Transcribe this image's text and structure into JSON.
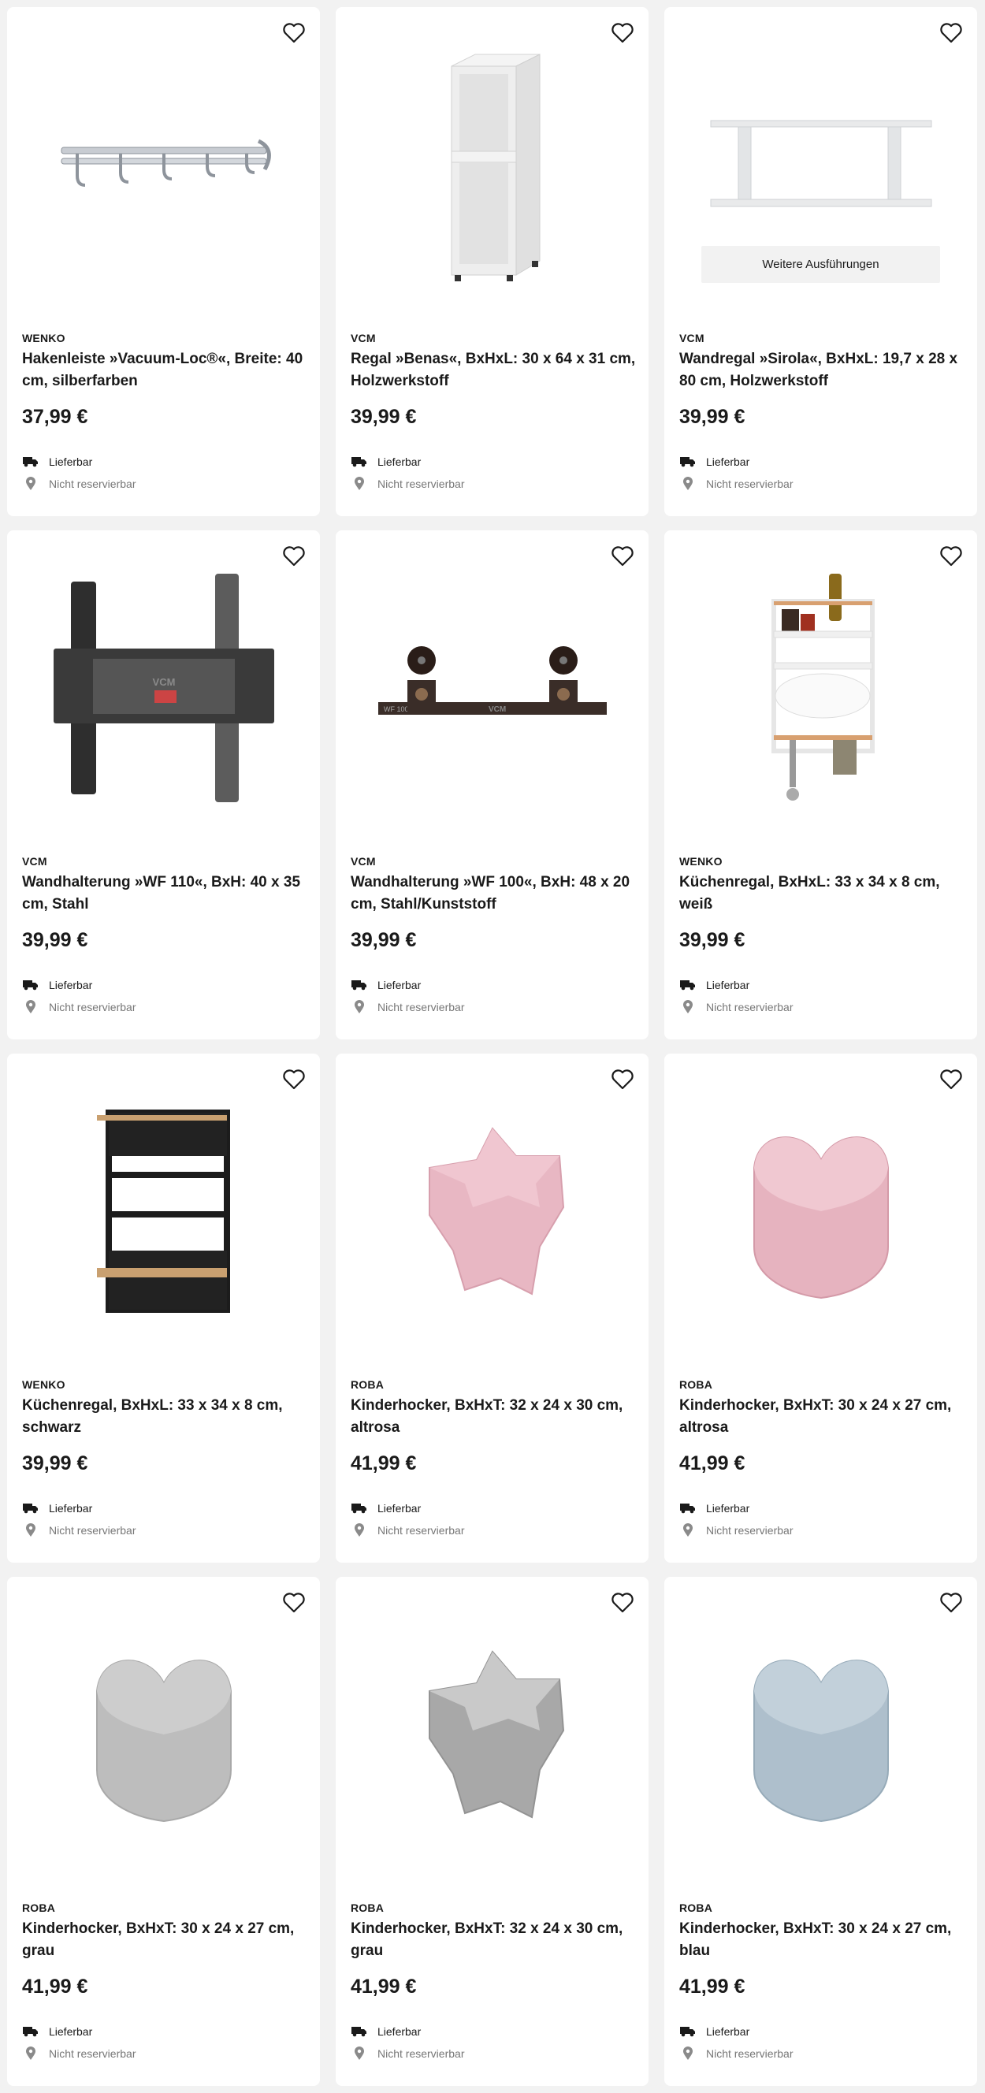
{
  "products": [
    {
      "brand": "WENKO",
      "title": "Hakenleiste »Vacuum-Loc®«, Breite: 40 cm, silberfarben",
      "price": "37,99 €",
      "delivery": "Lieferbar",
      "reserve": "Nicht reservierbar",
      "image": "hook-rail"
    },
    {
      "brand": "VCM",
      "title": "Regal »Benas«, BxHxL: 30 x 64 x 31 cm, Holzwerkstoff",
      "price": "39,99 €",
      "delivery": "Lieferbar",
      "reserve": "Nicht reservierbar",
      "image": "shelf-tower"
    },
    {
      "brand": "VCM",
      "title": "Wandregal »Sirola«, BxHxL: 19,7 x 28 x 80 cm, Holzwerkstoff",
      "price": "39,99 €",
      "delivery": "Lieferbar",
      "reserve": "Nicht reservierbar",
      "image": "wall-shelf",
      "variants_label": "Weitere Ausführungen"
    },
    {
      "brand": "VCM",
      "title": "Wandhalterung »WF 110«, BxH: 40 x 35 cm, Stahl",
      "price": "39,99 €",
      "delivery": "Lieferbar",
      "reserve": "Nicht reservierbar",
      "image": "tv-mount-wf110"
    },
    {
      "brand": "VCM",
      "title": "Wandhalterung »WF 100«, BxH: 48 x 20 cm, Stahl/Kunststoff",
      "price": "39,99 €",
      "delivery": "Lieferbar",
      "reserve": "Nicht reservierbar",
      "image": "tv-mount-wf100"
    },
    {
      "brand": "WENKO",
      "title": "Küchenregal, BxHxL: 33 x 34 x 8 cm, weiß",
      "price": "39,99 €",
      "delivery": "Lieferbar",
      "reserve": "Nicht reservierbar",
      "image": "kitchen-rack-white"
    },
    {
      "brand": "WENKO",
      "title": "Küchenregal, BxHxL: 33 x 34 x 8 cm, schwarz",
      "price": "39,99 €",
      "delivery": "Lieferbar",
      "reserve": "Nicht reservierbar",
      "image": "kitchen-rack-black"
    },
    {
      "brand": "ROBA",
      "title": "Kinderhocker, BxHxT: 32 x 24 x 30 cm, altrosa",
      "price": "41,99 €",
      "delivery": "Lieferbar",
      "reserve": "Nicht reservierbar",
      "image": "stool-star-pink"
    },
    {
      "brand": "ROBA",
      "title": "Kinderhocker, BxHxT: 30 x 24 x 27 cm, altrosa",
      "price": "41,99 €",
      "delivery": "Lieferbar",
      "reserve": "Nicht reservierbar",
      "image": "stool-heart-pink"
    },
    {
      "brand": "ROBA",
      "title": "Kinderhocker, BxHxT: 30 x 24 x 27 cm, grau",
      "price": "41,99 €",
      "delivery": "Lieferbar",
      "reserve": "Nicht reservierbar",
      "image": "stool-heart-grey"
    },
    {
      "brand": "ROBA",
      "title": "Kinderhocker, BxHxT: 32 x 24 x 30 cm, grau",
      "price": "41,99 €",
      "delivery": "Lieferbar",
      "reserve": "Nicht reservierbar",
      "image": "stool-star-grey"
    },
    {
      "brand": "ROBA",
      "title": "Kinderhocker, BxHxT: 30 x 24 x 27 cm, blau",
      "price": "41,99 €",
      "delivery": "Lieferbar",
      "reserve": "Nicht reservierbar",
      "image": "stool-heart-blue"
    }
  ],
  "mount_labels": {
    "wf110": "VCM",
    "wf100_model": "WF 100",
    "wf100_brand": "VCM"
  },
  "colors": {
    "background": "#f2f2f2",
    "card": "#ffffff",
    "text": "#1a1a1a",
    "muted": "#777777",
    "pink": "#e8b7c3",
    "grey": "#bdbdbd",
    "blue": "#aebfcc"
  }
}
